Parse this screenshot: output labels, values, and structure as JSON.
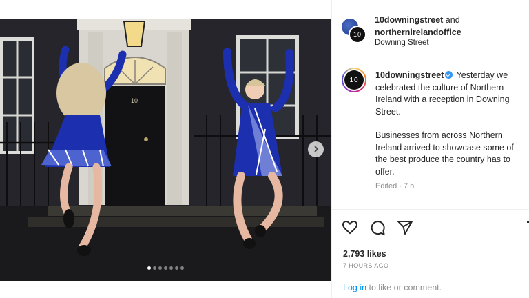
{
  "post": {
    "owners": {
      "first": "10downingstreet",
      "joiner": " and",
      "second": "northernirelandoffice"
    },
    "location": "Downing Street",
    "avatar_text": "10"
  },
  "caption": {
    "username": "10downingstreet",
    "line1": " Yesterday we celebrated the culture of Northern Ireland with a reception in Downing Street.",
    "line2": "Businesses from across Northern Ireland arrived to showcase some of the best produce the country has to offer.",
    "edited": "Edited · 7 h"
  },
  "door_number": "10",
  "carousel": {
    "count": 7,
    "active": 0
  },
  "stats": {
    "likes": "2,793 likes",
    "time": "7 HOURS AGO"
  },
  "login": {
    "link": "Log in",
    "rest": " to like or comment."
  },
  "icons": {
    "like": "heart-icon",
    "comment": "comment-icon",
    "share": "share-icon",
    "next": "chevron-right-icon",
    "verified": "verified-badge-icon"
  },
  "colors": {
    "link": "#0095f6",
    "verified": "#3897f0",
    "dress": "#1c2fae"
  }
}
